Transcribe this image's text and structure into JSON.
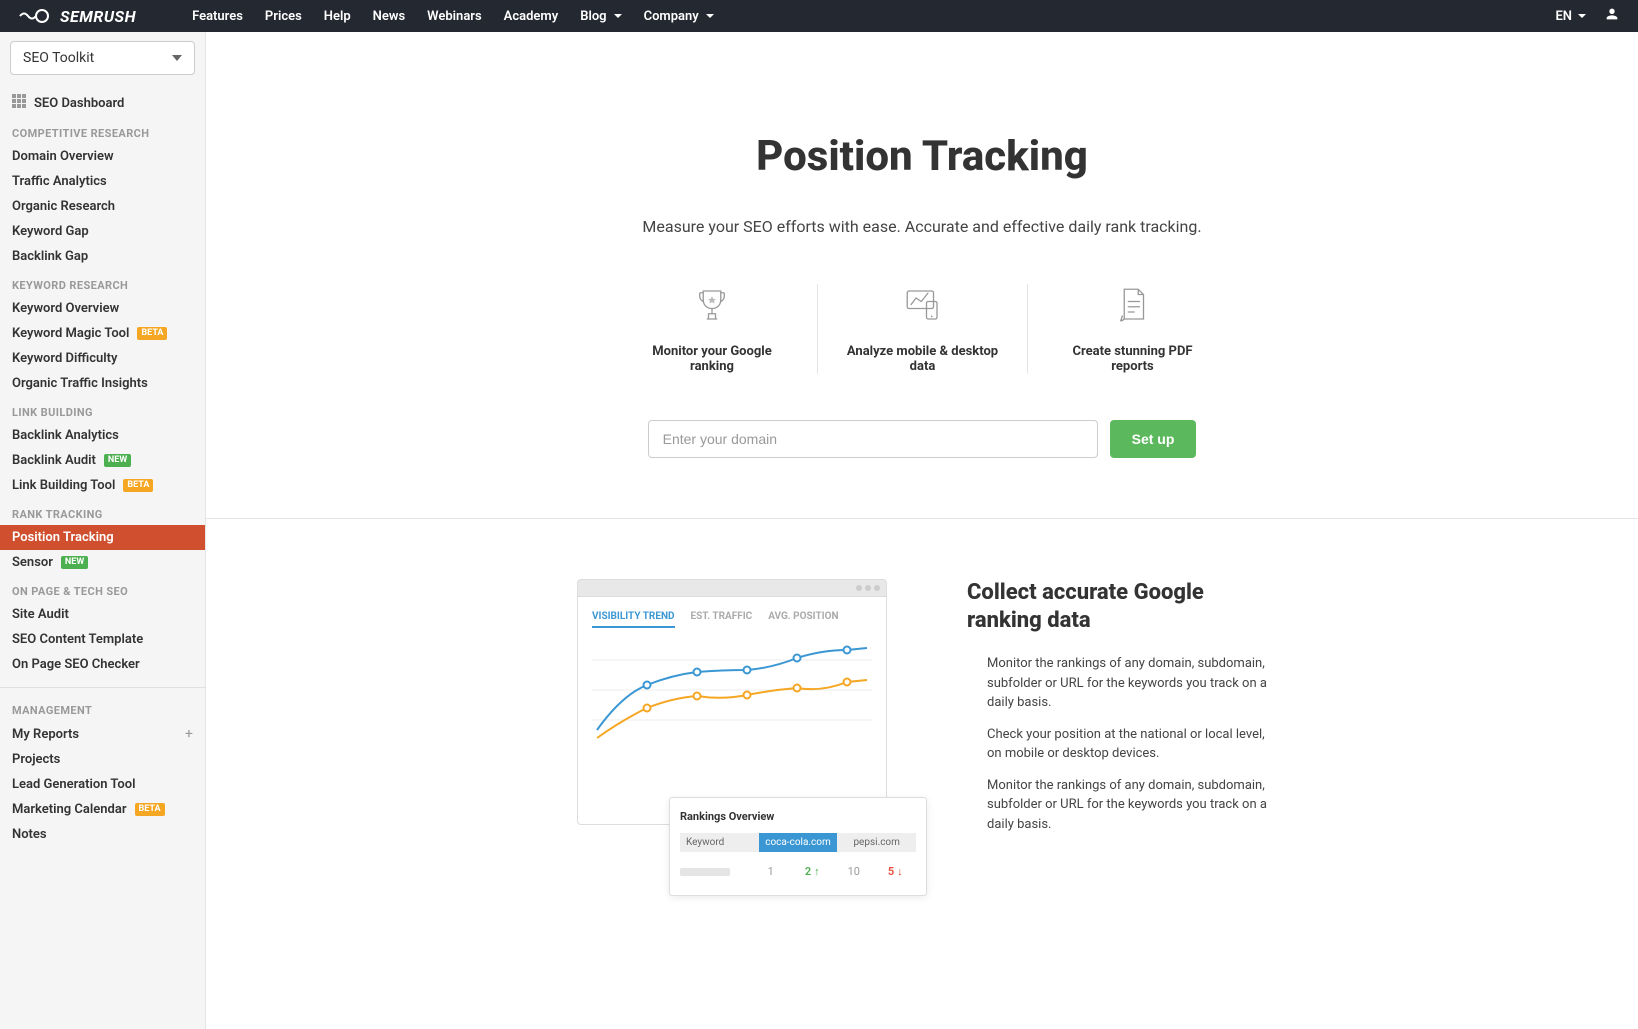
{
  "brand": "SEMRUSH",
  "topnav": {
    "items": [
      "Features",
      "Prices",
      "Help",
      "News",
      "Webinars",
      "Academy",
      "Blog",
      "Company"
    ],
    "lang": "EN"
  },
  "sidebar": {
    "toolkit": "SEO Toolkit",
    "dashboard": "SEO Dashboard",
    "sections": [
      {
        "label": "COMPETITIVE RESEARCH",
        "items": [
          {
            "label": "Domain Overview"
          },
          {
            "label": "Traffic Analytics"
          },
          {
            "label": "Organic Research"
          },
          {
            "label": "Keyword Gap"
          },
          {
            "label": "Backlink Gap"
          }
        ]
      },
      {
        "label": "KEYWORD RESEARCH",
        "items": [
          {
            "label": "Keyword Overview"
          },
          {
            "label": "Keyword Magic Tool",
            "badge": "BETA"
          },
          {
            "label": "Keyword Difficulty"
          },
          {
            "label": "Organic Traffic Insights"
          }
        ]
      },
      {
        "label": "LINK BUILDING",
        "items": [
          {
            "label": "Backlink Analytics"
          },
          {
            "label": "Backlink Audit",
            "badge": "NEW"
          },
          {
            "label": "Link Building Tool",
            "badge": "BETA"
          }
        ]
      },
      {
        "label": "RANK TRACKING",
        "items": [
          {
            "label": "Position Tracking",
            "active": true
          },
          {
            "label": "Sensor",
            "badge": "NEW"
          }
        ]
      },
      {
        "label": "ON PAGE & TECH SEO",
        "items": [
          {
            "label": "Site Audit"
          },
          {
            "label": "SEO Content Template"
          },
          {
            "label": "On Page SEO Checker"
          }
        ]
      }
    ],
    "management": {
      "label": "MANAGEMENT",
      "items": [
        {
          "label": "My Reports",
          "plus": true
        },
        {
          "label": "Projects"
        },
        {
          "label": "Lead Generation Tool"
        },
        {
          "label": "Marketing Calendar",
          "badge": "BETA"
        },
        {
          "label": "Notes"
        }
      ]
    }
  },
  "hero": {
    "title": "Position Tracking",
    "subtitle": "Measure your SEO efforts with ease. Accurate and effective daily rank tracking.",
    "features": [
      "Monitor your Google ranking",
      "Analyze mobile & desktop data",
      "Create stunning PDF reports"
    ],
    "placeholder": "Enter your domain",
    "button": "Set up"
  },
  "promo": {
    "chart_tabs": [
      "VISIBILITY TREND",
      "EST. TRAFFIC",
      "AVG. POSITION"
    ],
    "overview_title": "Rankings Overview",
    "overview_headers": {
      "keyword": "Keyword",
      "domains": [
        "coca-cola.com",
        "pepsi.com"
      ]
    },
    "overview_row": {
      "vals": [
        "1",
        "2",
        "10",
        "5"
      ]
    },
    "heading": "Collect accurate Google ranking data",
    "paragraphs": [
      "Monitor the rankings of any domain, subdomain, subfolder or URL for the keywords you track on a daily basis.",
      "Check your position at the national or local level, on mobile or desktop devices.",
      "Monitor the rankings of any domain, subdomain, subfolder or URL for the keywords you track on a daily basis."
    ]
  }
}
